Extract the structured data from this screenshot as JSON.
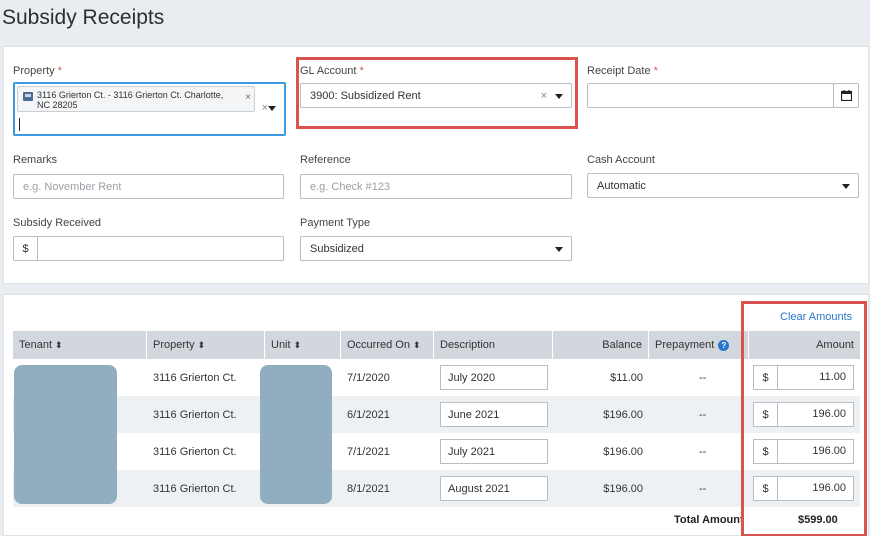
{
  "page": {
    "title": "Subsidy Receipts"
  },
  "form": {
    "property": {
      "label": "Property",
      "required_mark": "*",
      "chip": "3116 Grierton Ct. - 3116 Grierton Ct. Charlotte, NC 28205",
      "clear": "×"
    },
    "gl_account": {
      "label": "GL Account",
      "required_mark": "*",
      "value": "3900: Subsidized Rent",
      "clear": "×"
    },
    "receipt_date": {
      "label": "Receipt Date",
      "required_mark": "*",
      "value": ""
    },
    "remarks": {
      "label": "Remarks",
      "placeholder": "e.g. November Rent"
    },
    "reference": {
      "label": "Reference",
      "placeholder": "e.g. Check #123"
    },
    "cash_account": {
      "label": "Cash Account",
      "value": "Automatic"
    },
    "subsidy_received": {
      "label": "Subsidy Received",
      "prefix": "$",
      "value": ""
    },
    "payment_type": {
      "label": "Payment Type",
      "value": "Subsidized"
    }
  },
  "table": {
    "clear_amounts": "Clear Amounts",
    "columns": {
      "tenant": "Tenant",
      "property": "Property",
      "unit": "Unit",
      "occurred_on": "Occurred On",
      "description": "Description",
      "balance": "Balance",
      "prepayment": "Prepayment",
      "amount": "Amount"
    },
    "sort_icon": "⬍",
    "rows": [
      {
        "property": "3116 Grierton Ct.",
        "occurred_on": "7/1/2020",
        "description": "July 2020",
        "balance": "$11.00",
        "prepayment": "--",
        "currency": "$",
        "amount": "11.00"
      },
      {
        "property": "3116 Grierton Ct.",
        "occurred_on": "6/1/2021",
        "description": "June 2021",
        "balance": "$196.00",
        "prepayment": "--",
        "currency": "$",
        "amount": "196.00"
      },
      {
        "property": "3116 Grierton Ct.",
        "occurred_on": "7/1/2021",
        "description": "July 2021",
        "balance": "$196.00",
        "prepayment": "--",
        "currency": "$",
        "amount": "196.00"
      },
      {
        "property": "3116 Grierton Ct.",
        "occurred_on": "8/1/2021",
        "description": "August 2021",
        "balance": "$196.00",
        "prepayment": "--",
        "currency": "$",
        "amount": "196.00"
      }
    ],
    "total_label": "Total Amount",
    "total_value": "$599.00"
  },
  "colors": {
    "highlight": "#d9534f",
    "focus": "#3a9be0",
    "link": "#2a74c9",
    "header_bg": "#d1d7dd"
  },
  "icons": [
    "calendar-icon",
    "sort-icon",
    "help-icon",
    "building-icon",
    "clear-icon",
    "chevron-down-icon"
  ]
}
